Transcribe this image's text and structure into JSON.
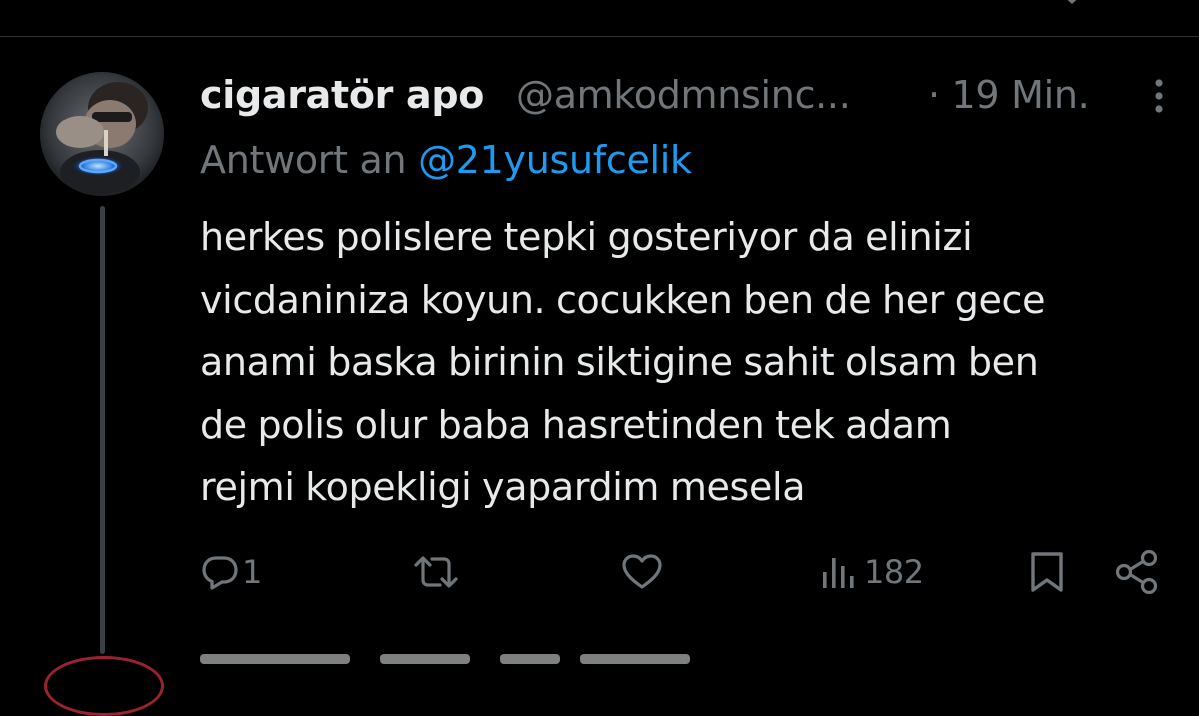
{
  "tweet": {
    "display_name": "cigaratör apo",
    "handle": "@amkodmnsinc...",
    "time": "· 19 Min.",
    "reply_prefix": "Antwort an",
    "reply_to": "@21yusufcelik",
    "text_lines": [
      "herkes polislere tepki gosteriyor da elinizi",
      "vicdaniniza koyun. cocukken ben de her gece",
      "anami baska birinin siktigine sahit olsam ben",
      "de polis olur baba hasretinden tek adam",
      "rejmi kopekligi yapardim mesela"
    ]
  },
  "actions": {
    "reply_count": "1",
    "retweet_count": "",
    "like_count": "",
    "views_count": "182"
  },
  "colors": {
    "background": "#000000",
    "text_primary": "#e7e9ea",
    "text_secondary": "#71767b",
    "link": "#1d9bf0",
    "divider": "#2f3336",
    "thread_line": "#3a3f43"
  },
  "icons": [
    "ellipsis-vertical-icon",
    "reply-icon",
    "retweet-icon",
    "like-icon",
    "views-icon",
    "bookmark-icon",
    "share-icon"
  ]
}
